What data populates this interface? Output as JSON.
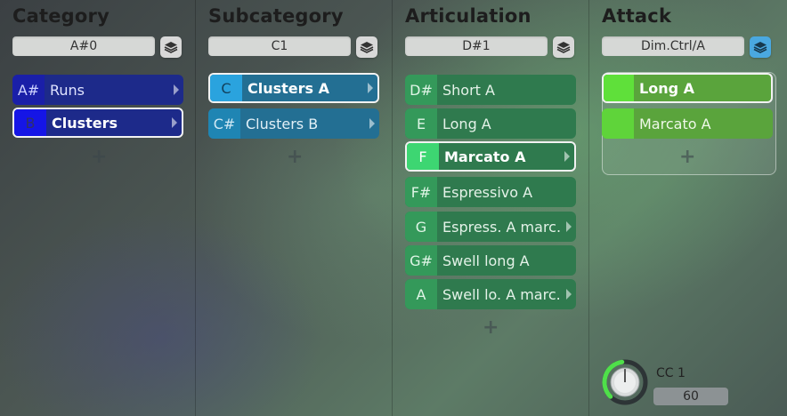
{
  "columns": [
    {
      "title": "Category",
      "field": "A#0",
      "items": [
        {
          "key": "A#",
          "label": "Runs"
        },
        {
          "key": "B",
          "label": "Clusters"
        }
      ]
    },
    {
      "title": "Subcategory",
      "field": "C1",
      "items": [
        {
          "key": "C",
          "label": "Clusters A"
        },
        {
          "key": "C#",
          "label": "Clusters B"
        }
      ]
    },
    {
      "title": "Articulation",
      "field": "D#1",
      "items": [
        {
          "key": "D#",
          "label": "Short A"
        },
        {
          "key": "E",
          "label": "Long A"
        },
        {
          "key": "F",
          "label": "Marcato A"
        },
        {
          "key": "F#",
          "label": "Espressivo A"
        },
        {
          "key": "G",
          "label": "Espress. A marc."
        },
        {
          "key": "G#",
          "label": "Swell long A"
        },
        {
          "key": "A",
          "label": "Swell lo. A marc."
        }
      ]
    },
    {
      "title": "Attack",
      "field": "Dim.Ctrl/A",
      "items": [
        {
          "label": "Long A"
        },
        {
          "label": "Marcato A"
        }
      ]
    }
  ],
  "controller": {
    "label": "CC 1",
    "value": "60",
    "level": 0.47
  },
  "colors": {
    "category_item": "#1d2a8a",
    "category_selected_key": "#1515e6",
    "subcategory_item": "#236f93",
    "subcategory_selected_key": "#2aa3de",
    "articulation_item": "#2f7a4e",
    "articulation_selected_key": "#3dd672",
    "attack_selected": "#5fd43a",
    "attack_item": "#5aa43c",
    "knob_ring": "#4fe04a"
  },
  "icons": {
    "layer_button": "stack-layers-icon",
    "add": "plus-icon",
    "submenu": "arrow-right-icon"
  }
}
